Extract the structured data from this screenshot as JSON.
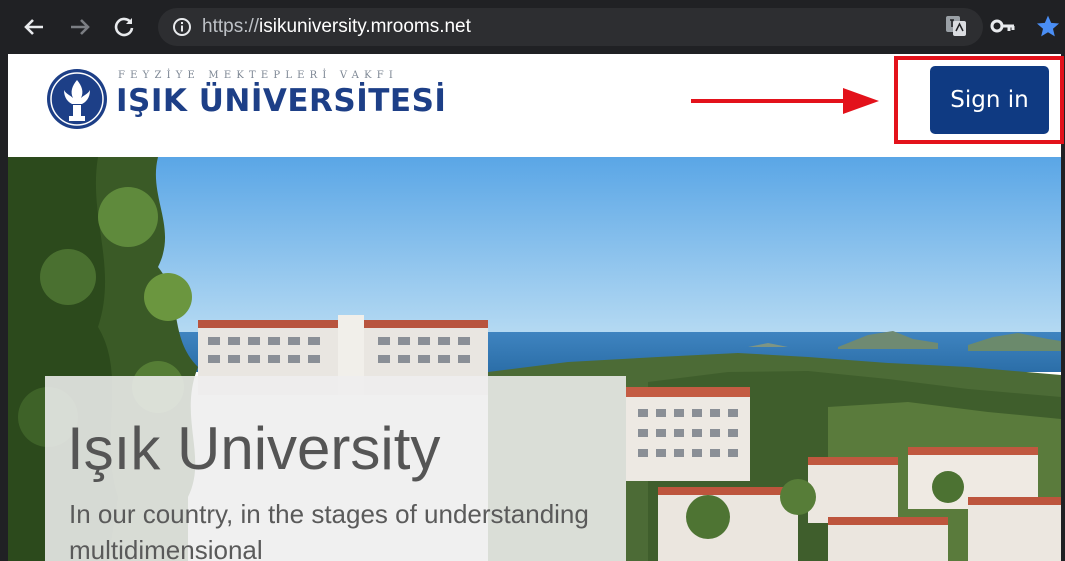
{
  "browser": {
    "url_scheme": "https://",
    "url_host": "isikuniversity.mrooms.net",
    "icons": [
      "back-arrow-icon",
      "forward-arrow-icon",
      "reload-icon",
      "info-icon",
      "translate-icon",
      "key-icon",
      "bookmark-star-icon"
    ]
  },
  "header": {
    "foundation_text": "FEYZİYE MEKTEPLERİ VAKFI",
    "university_name": "IŞIK ÜNİVERSİTESİ",
    "sign_in_label": "Sign in"
  },
  "annotation": {
    "arrow_color": "#e3121b",
    "highlight_color": "#e3121b"
  },
  "hero": {
    "title": "Işık University",
    "text": "In our country, in the stages of understanding multidimensional"
  },
  "colors": {
    "brand_blue": "#0f3a82",
    "chrome_bg": "#202124"
  }
}
